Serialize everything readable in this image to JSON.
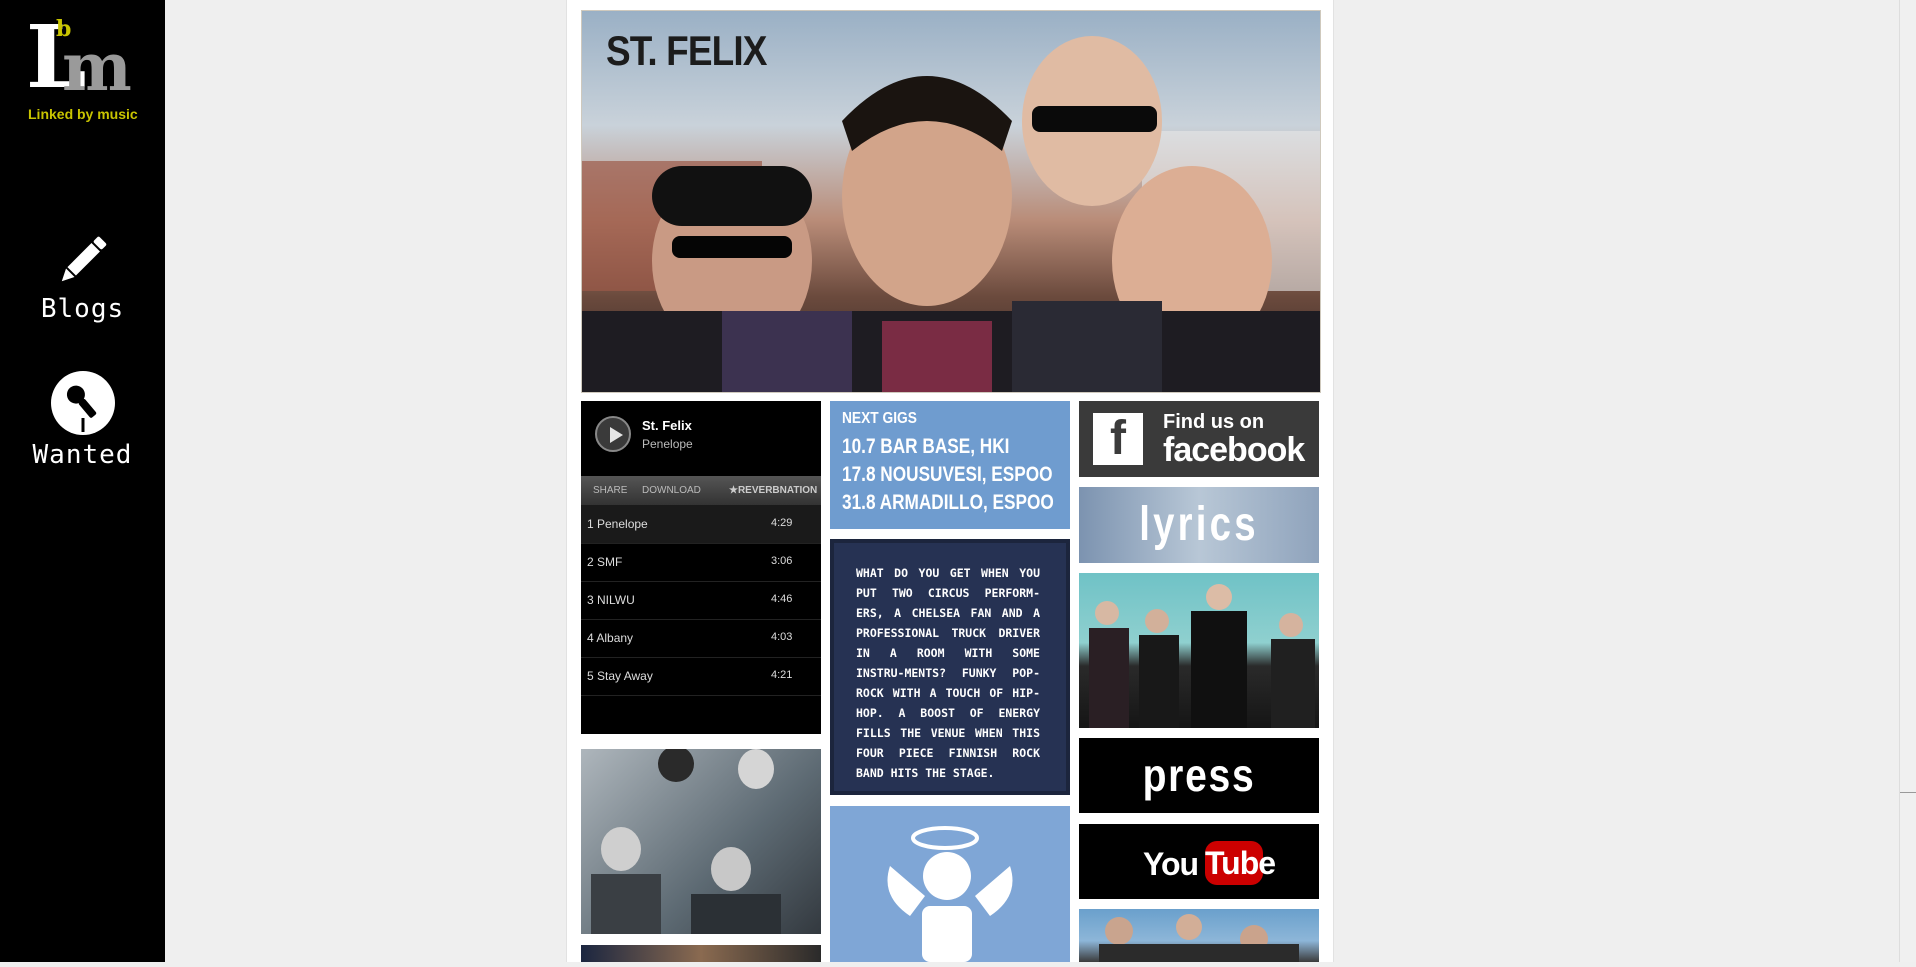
{
  "sidebar": {
    "logo": {
      "letter_l": "L",
      "letter_b": "b",
      "letter_m": "m",
      "tagline": "Linked by music"
    },
    "items": [
      {
        "label": "Blogs",
        "icon": "pencil-icon"
      },
      {
        "label": "Wanted",
        "icon": "microphone-icon"
      }
    ]
  },
  "hero": {
    "title": "ST. FELIX"
  },
  "player": {
    "artist": "St. Felix",
    "current_song": "Penelope",
    "share": "SHARE",
    "download": "DOWNLOAD",
    "brand": "★REVERBNATION",
    "tracks": [
      {
        "title": "1 Penelope",
        "time": "4:29"
      },
      {
        "title": "2 SMF",
        "time": "3:06"
      },
      {
        "title": "3 NILWU",
        "time": "4:46"
      },
      {
        "title": "4 Albany",
        "time": "4:03"
      },
      {
        "title": "5 Stay Away",
        "time": "4:21"
      }
    ]
  },
  "gigs": {
    "heading": "NEXT GIGS",
    "items": [
      "10.7 BAR BASE, HKI",
      "17.8 NOUSUVESI, ESPOO",
      "31.8 ARMADILLO, ESPOO"
    ]
  },
  "about": {
    "text": "WHAT DO YOU GET WHEN YOU PUT TWO CIRCUS PERFORM-ERS, A CHELSEA FAN AND A PROFESSIONAL TRUCK DRIVER IN A ROOM WITH SOME INSTRU-MENTS? FUNKY POP-ROCK WITH A TOUCH OF HIP-HOP. A BOOST OF ENERGY FILLS THE VENUE WHEN THIS FOUR PIECE FINNISH ROCK BAND HITS THE STAGE."
  },
  "links": {
    "facebook_line1": "Find us on",
    "facebook_line2": "facebook",
    "facebook_letter": "f",
    "lyrics": "lyrics",
    "press": "press",
    "youtube_you": "You",
    "youtube_tube": "Tube"
  }
}
